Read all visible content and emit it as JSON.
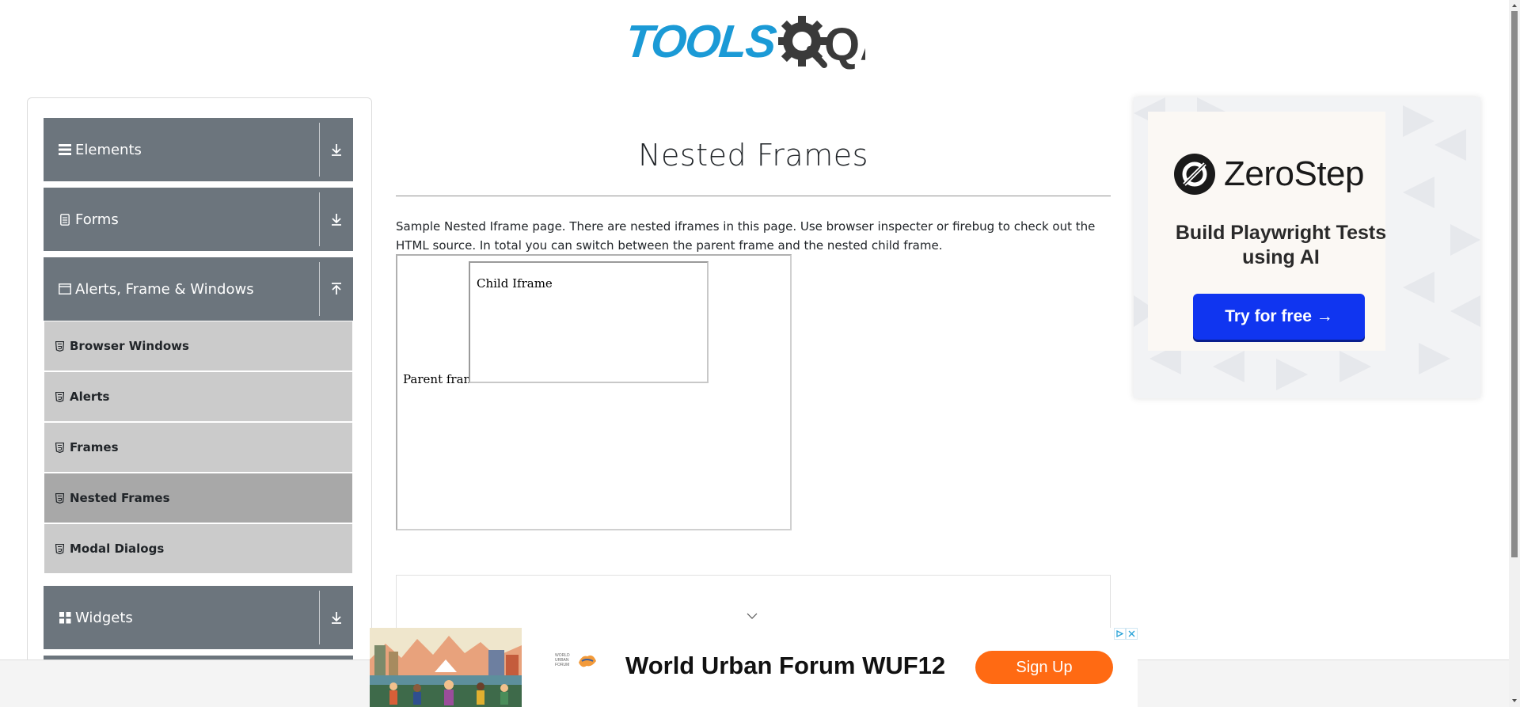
{
  "header": {
    "logo_text_left": "TOOLS",
    "logo_text_right": "QA"
  },
  "sidebar": {
    "groups": [
      {
        "label": "Elements",
        "icon": "hamburger-icon",
        "state": "collapsed"
      },
      {
        "label": "Forms",
        "icon": "document-icon",
        "state": "collapsed"
      },
      {
        "label": "Alerts, Frame & Windows",
        "icon": "window-icon",
        "state": "expanded"
      },
      {
        "label": "Widgets",
        "icon": "grid-icon",
        "state": "collapsed"
      }
    ],
    "items": [
      {
        "label": "Browser Windows",
        "active": false
      },
      {
        "label": "Alerts",
        "active": false
      },
      {
        "label": "Frames",
        "active": false
      },
      {
        "label": "Nested Frames",
        "active": true
      },
      {
        "label": "Modal Dialogs",
        "active": false
      }
    ]
  },
  "main": {
    "title": "Nested Frames",
    "description": "Sample Nested Iframe page. There are nested iframes in this page. Use browser inspecter or firebug to check out the HTML source. In total you can switch between the parent frame and the nested child frame.",
    "parent_frame_label": "Parent frame",
    "child_frame_label": "Child Iframe"
  },
  "ad_right": {
    "brand": "ZeroStep",
    "headline": "Build Playwright Tests using AI",
    "cta": "Try for free →"
  },
  "banner_ad": {
    "headline": "World Urban Forum WUF12",
    "cta": "Sign Up",
    "logo_small_text": "WORLD URBAN FORUM"
  },
  "colors": {
    "sidebar_header": "#6c757d",
    "sidebar_item": "#cbcbcb",
    "sidebar_item_active": "#a8a8a8",
    "logo_blue": "#1b9ad6",
    "ad_cta_blue": "#1035f0",
    "banner_cta_orange": "#ff6a13"
  }
}
